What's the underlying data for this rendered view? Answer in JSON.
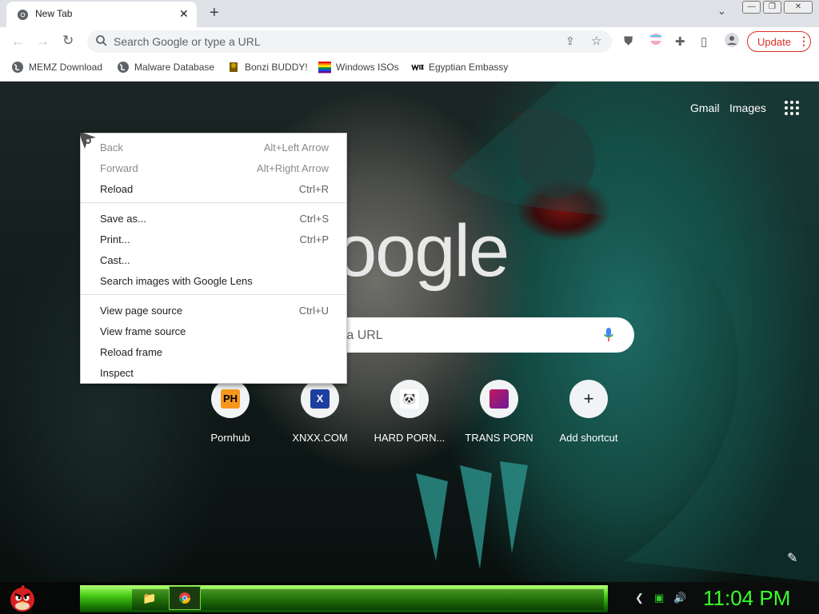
{
  "tab": {
    "title": "New Tab",
    "close": "✕",
    "new_tab": "+",
    "tab_search": "⌄"
  },
  "window": {
    "minimize": "—",
    "restore": "❐",
    "close": "✕"
  },
  "toolbar": {
    "back": "←",
    "forward": "→",
    "reload": "↻",
    "omnibox_placeholder": "Search Google or type a URL",
    "update_label": "Update",
    "menu_dots": "⋮"
  },
  "bookmarks": [
    {
      "label": "MEMZ Download",
      "icon": "globe-icon"
    },
    {
      "label": "Malware Database",
      "icon": "globe-icon"
    },
    {
      "label": "Bonzi BUDDY!",
      "icon": "bonzi-icon"
    },
    {
      "label": "Windows ISOs",
      "icon": "rainbow-flag-icon"
    },
    {
      "label": "Egyptian Embassy",
      "icon": "wix-icon"
    }
  ],
  "ntp": {
    "gmail": "Gmail",
    "images": "Images",
    "logo": "oogle",
    "search_placeholder": "e a URL",
    "shortcuts": [
      {
        "label": "Pornhub",
        "icon_text": "PH"
      },
      {
        "label": "XNXX.COM",
        "icon_text": "X"
      },
      {
        "label": "HARD PORN...",
        "icon_text": "🐼"
      },
      {
        "label": "TRANS PORN",
        "icon_text": ""
      },
      {
        "label": "Add shortcut",
        "icon_text": "+"
      }
    ]
  },
  "context_menu": {
    "items": [
      {
        "label": "Back",
        "shortcut": "Alt+Left Arrow",
        "disabled": true
      },
      {
        "label": "Forward",
        "shortcut": "Alt+Right Arrow",
        "disabled": true
      },
      {
        "label": "Reload",
        "shortcut": "Ctrl+R",
        "disabled": false
      },
      {
        "label": "Save as...",
        "shortcut": "Ctrl+S",
        "disabled": false
      },
      {
        "label": "Print...",
        "shortcut": "Ctrl+P",
        "disabled": false
      },
      {
        "label": "Cast...",
        "shortcut": "",
        "disabled": false
      },
      {
        "label": "Search images with Google Lens",
        "shortcut": "",
        "disabled": false
      },
      {
        "label": "View page source",
        "shortcut": "Ctrl+U",
        "disabled": false
      },
      {
        "label": "View frame source",
        "shortcut": "",
        "disabled": false
      },
      {
        "label": "Reload frame",
        "shortcut": "",
        "disabled": false
      },
      {
        "label": "Inspect",
        "shortcut": "",
        "disabled": false
      }
    ]
  },
  "taskbar": {
    "clock": "11:04 PM"
  },
  "colors": {
    "accent_red": "#d93025",
    "clock_green": "#3aff2a",
    "taskbar_green": "#4fd11a"
  }
}
